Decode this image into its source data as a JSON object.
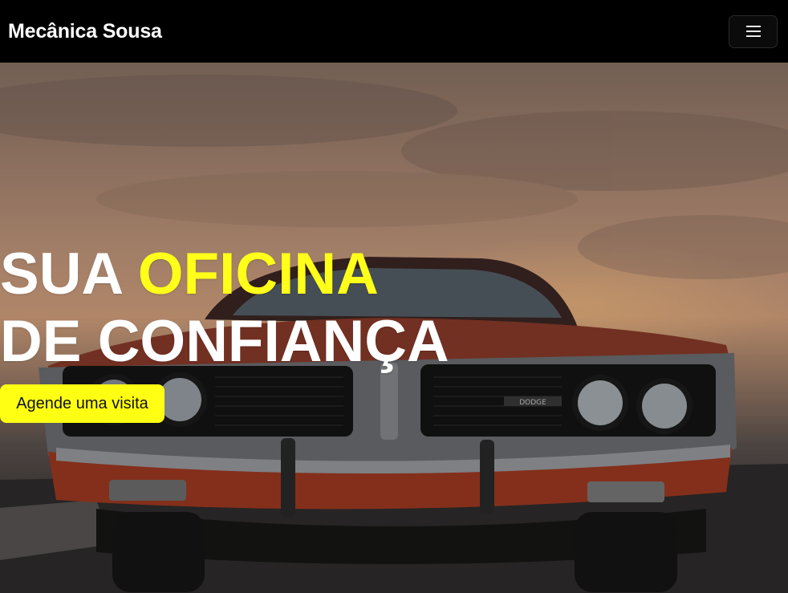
{
  "navbar": {
    "brand": "Mecânica Sousa",
    "menu_icon": "hamburger-icon"
  },
  "hero": {
    "title_part1": "SUA ",
    "title_accent": "OFICINA",
    "title_line2": "DE CONFIANÇA",
    "cta_label": "Agende uma visita",
    "background_image": "red-classic-car-front-sunset",
    "car_badge": "DODGE"
  },
  "colors": {
    "accent": "#ffff19",
    "navbar_bg": "#000000",
    "text": "#ffffff"
  }
}
